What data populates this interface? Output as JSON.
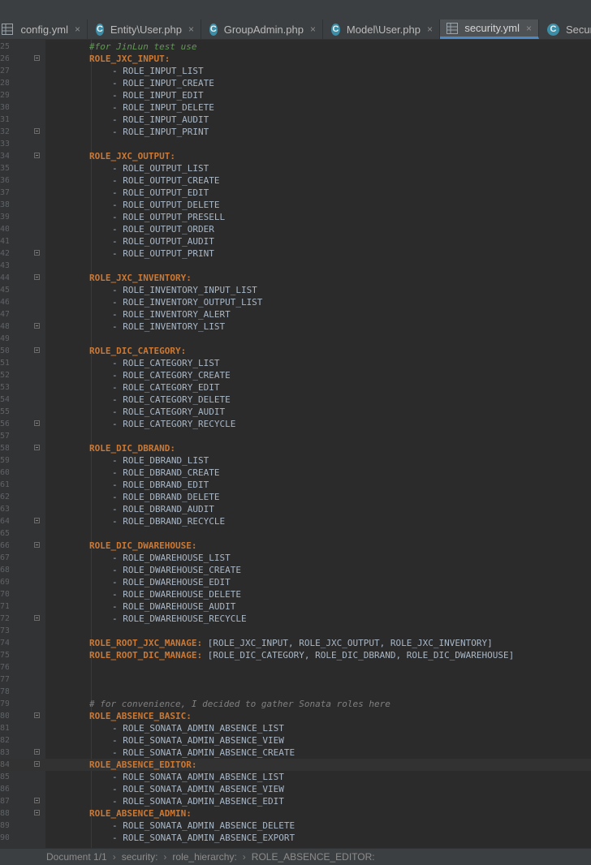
{
  "tabs": [
    {
      "label": "config.yml",
      "icon": "yaml-file-icon",
      "active": false,
      "close": "×"
    },
    {
      "label": "Entity\\User.php",
      "icon": "php-class-icon",
      "active": false,
      "close": "×"
    },
    {
      "label": "GroupAdmin.php",
      "icon": "php-class-icon",
      "active": false,
      "close": "×"
    },
    {
      "label": "Model\\User.php",
      "icon": "php-class-icon",
      "active": false,
      "close": "×"
    },
    {
      "label": "security.yml",
      "icon": "yaml-file-icon",
      "active": true,
      "close": "×"
    },
    {
      "label": "Securi",
      "icon": "php-class-icon",
      "active": false,
      "close": ""
    }
  ],
  "current_line": 84,
  "lines": [
    {
      "n": 25,
      "kind": "comment",
      "indent": 8,
      "text": "#for JinLun test use"
    },
    {
      "n": 26,
      "kind": "key",
      "indent": 8,
      "text": "ROLE_JXC_INPUT:",
      "fold": true
    },
    {
      "n": 27,
      "kind": "item",
      "indent": 12,
      "text": "- ROLE_INPUT_LIST"
    },
    {
      "n": 28,
      "kind": "item",
      "indent": 12,
      "text": "- ROLE_INPUT_CREATE"
    },
    {
      "n": 29,
      "kind": "item",
      "indent": 12,
      "text": "- ROLE_INPUT_EDIT"
    },
    {
      "n": 30,
      "kind": "item",
      "indent": 12,
      "text": "- ROLE_INPUT_DELETE"
    },
    {
      "n": 31,
      "kind": "item",
      "indent": 12,
      "text": "- ROLE_INPUT_AUDIT"
    },
    {
      "n": 32,
      "kind": "item",
      "indent": 12,
      "text": "- ROLE_INPUT_PRINT",
      "fold": true
    },
    {
      "n": 33,
      "kind": "empty",
      "indent": 0,
      "text": ""
    },
    {
      "n": 34,
      "kind": "key",
      "indent": 8,
      "text": "ROLE_JXC_OUTPUT:",
      "fold": true
    },
    {
      "n": 35,
      "kind": "item",
      "indent": 12,
      "text": "- ROLE_OUTPUT_LIST"
    },
    {
      "n": 36,
      "kind": "item",
      "indent": 12,
      "text": "- ROLE_OUTPUT_CREATE"
    },
    {
      "n": 37,
      "kind": "item",
      "indent": 12,
      "text": "- ROLE_OUTPUT_EDIT"
    },
    {
      "n": 38,
      "kind": "item",
      "indent": 12,
      "text": "- ROLE_OUTPUT_DELETE"
    },
    {
      "n": 39,
      "kind": "item",
      "indent": 12,
      "text": "- ROLE_OUTPUT_PRESELL"
    },
    {
      "n": 40,
      "kind": "item",
      "indent": 12,
      "text": "- ROLE_OUTPUT_ORDER"
    },
    {
      "n": 41,
      "kind": "item",
      "indent": 12,
      "text": "- ROLE_OUTPUT_AUDIT"
    },
    {
      "n": 42,
      "kind": "item",
      "indent": 12,
      "text": "- ROLE_OUTPUT_PRINT",
      "fold": true
    },
    {
      "n": 43,
      "kind": "empty",
      "indent": 0,
      "text": ""
    },
    {
      "n": 44,
      "kind": "key",
      "indent": 8,
      "text": "ROLE_JXC_INVENTORY:",
      "fold": true
    },
    {
      "n": 45,
      "kind": "item",
      "indent": 12,
      "text": "- ROLE_INVENTORY_INPUT_LIST"
    },
    {
      "n": 46,
      "kind": "item",
      "indent": 12,
      "text": "- ROLE_INVENTORY_OUTPUT_LIST"
    },
    {
      "n": 47,
      "kind": "item",
      "indent": 12,
      "text": "- ROLE_INVENTORY_ALERT"
    },
    {
      "n": 48,
      "kind": "item",
      "indent": 12,
      "text": "- ROLE_INVENTORY_LIST",
      "fold": true
    },
    {
      "n": 49,
      "kind": "empty",
      "indent": 0,
      "text": ""
    },
    {
      "n": 50,
      "kind": "key",
      "indent": 8,
      "text": "ROLE_DIC_CATEGORY:",
      "fold": true
    },
    {
      "n": 51,
      "kind": "item",
      "indent": 12,
      "text": "- ROLE_CATEGORY_LIST"
    },
    {
      "n": 52,
      "kind": "item",
      "indent": 12,
      "text": "- ROLE_CATEGORY_CREATE"
    },
    {
      "n": 53,
      "kind": "item",
      "indent": 12,
      "text": "- ROLE_CATEGORY_EDIT"
    },
    {
      "n": 54,
      "kind": "item",
      "indent": 12,
      "text": "- ROLE_CATEGORY_DELETE"
    },
    {
      "n": 55,
      "kind": "item",
      "indent": 12,
      "text": "- ROLE_CATEGORY_AUDIT"
    },
    {
      "n": 56,
      "kind": "item",
      "indent": 12,
      "text": "- ROLE_CATEGORY_RECYCLE",
      "fold": true
    },
    {
      "n": 57,
      "kind": "empty",
      "indent": 0,
      "text": ""
    },
    {
      "n": 58,
      "kind": "key",
      "indent": 8,
      "text": "ROLE_DIC_DBRAND:",
      "fold": true
    },
    {
      "n": 59,
      "kind": "item",
      "indent": 12,
      "text": "- ROLE_DBRAND_LIST"
    },
    {
      "n": 60,
      "kind": "item",
      "indent": 12,
      "text": "- ROLE_DBRAND_CREATE"
    },
    {
      "n": 61,
      "kind": "item",
      "indent": 12,
      "text": "- ROLE_DBRAND_EDIT"
    },
    {
      "n": 62,
      "kind": "item",
      "indent": 12,
      "text": "- ROLE_DBRAND_DELETE"
    },
    {
      "n": 63,
      "kind": "item",
      "indent": 12,
      "text": "- ROLE_DBRAND_AUDIT"
    },
    {
      "n": 64,
      "kind": "item",
      "indent": 12,
      "text": "- ROLE_DBRAND_RECYCLE",
      "fold": true
    },
    {
      "n": 65,
      "kind": "empty",
      "indent": 0,
      "text": ""
    },
    {
      "n": 66,
      "kind": "key",
      "indent": 8,
      "text": "ROLE_DIC_DWAREHOUSE:",
      "fold": true
    },
    {
      "n": 67,
      "kind": "item",
      "indent": 12,
      "text": "- ROLE_DWAREHOUSE_LIST"
    },
    {
      "n": 68,
      "kind": "item",
      "indent": 12,
      "text": "- ROLE_DWAREHOUSE_CREATE"
    },
    {
      "n": 69,
      "kind": "item",
      "indent": 12,
      "text": "- ROLE_DWAREHOUSE_EDIT"
    },
    {
      "n": 70,
      "kind": "item",
      "indent": 12,
      "text": "- ROLE_DWAREHOUSE_DELETE"
    },
    {
      "n": 71,
      "kind": "item",
      "indent": 12,
      "text": "- ROLE_DWAREHOUSE_AUDIT"
    },
    {
      "n": 72,
      "kind": "item",
      "indent": 12,
      "text": "- ROLE_DWAREHOUSE_RECYCLE",
      "fold": true
    },
    {
      "n": 73,
      "kind": "empty",
      "indent": 0,
      "text": ""
    },
    {
      "n": 74,
      "kind": "keyval",
      "indent": 8,
      "text": "ROLE_ROOT_JXC_MANAGE:",
      "value": " [ROLE_JXC_INPUT, ROLE_JXC_OUTPUT, ROLE_JXC_INVENTORY]"
    },
    {
      "n": 75,
      "kind": "keyval",
      "indent": 8,
      "text": "ROLE_ROOT_DIC_MANAGE:",
      "value": " [ROLE_DIC_CATEGORY, ROLE_DIC_DBRAND, ROLE_DIC_DWAREHOUSE]"
    },
    {
      "n": 76,
      "kind": "empty",
      "indent": 0,
      "text": ""
    },
    {
      "n": 77,
      "kind": "empty",
      "indent": 0,
      "text": ""
    },
    {
      "n": 78,
      "kind": "empty",
      "indent": 0,
      "text": ""
    },
    {
      "n": 79,
      "kind": "comment",
      "indent": 8,
      "text": "# for convenience, I decided to gather Sonata roles here"
    },
    {
      "n": 80,
      "kind": "key",
      "indent": 8,
      "text": "ROLE_ABSENCE_BASIC:",
      "fold": true
    },
    {
      "n": 81,
      "kind": "item",
      "indent": 12,
      "text": "- ROLE_SONATA_ADMIN_ABSENCE_LIST"
    },
    {
      "n": 82,
      "kind": "item",
      "indent": 12,
      "text": "- ROLE_SONATA_ADMIN_ABSENCE_VIEW"
    },
    {
      "n": 83,
      "kind": "item",
      "indent": 12,
      "text": "- ROLE_SONATA_ADMIN_ABSENCE_CREATE",
      "fold": true
    },
    {
      "n": 84,
      "kind": "key",
      "indent": 8,
      "text": "ROLE_ABSENCE_EDITOR:",
      "fold": true
    },
    {
      "n": 85,
      "kind": "item",
      "indent": 12,
      "text": "- ROLE_SONATA_ADMIN_ABSENCE_LIST"
    },
    {
      "n": 86,
      "kind": "item",
      "indent": 12,
      "text": "- ROLE_SONATA_ADMIN_ABSENCE_VIEW"
    },
    {
      "n": 87,
      "kind": "item",
      "indent": 12,
      "text": "- ROLE_SONATA_ADMIN_ABSENCE_EDIT",
      "fold": true
    },
    {
      "n": 88,
      "kind": "key",
      "indent": 8,
      "text": "ROLE_ABSENCE_ADMIN:",
      "fold": true
    },
    {
      "n": 89,
      "kind": "item",
      "indent": 12,
      "text": "- ROLE_SONATA_ADMIN_ABSENCE_DELETE"
    },
    {
      "n": 90,
      "kind": "item",
      "indent": 12,
      "text": "- ROLE_SONATA_ADMIN_ABSENCE_EXPORT"
    }
  ],
  "breadcrumb": [
    "Document 1/1",
    "security:",
    "role_hierarchy:",
    "ROLE_ABSENCE_EDITOR:"
  ],
  "breadcrumb_separator": "›",
  "colors": {
    "key": "#cc7832",
    "comment": "#629755",
    "text": "#a9b7c6",
    "background": "#2b2b2b",
    "gutter": "#313335",
    "tab_active": "#4e5254"
  }
}
